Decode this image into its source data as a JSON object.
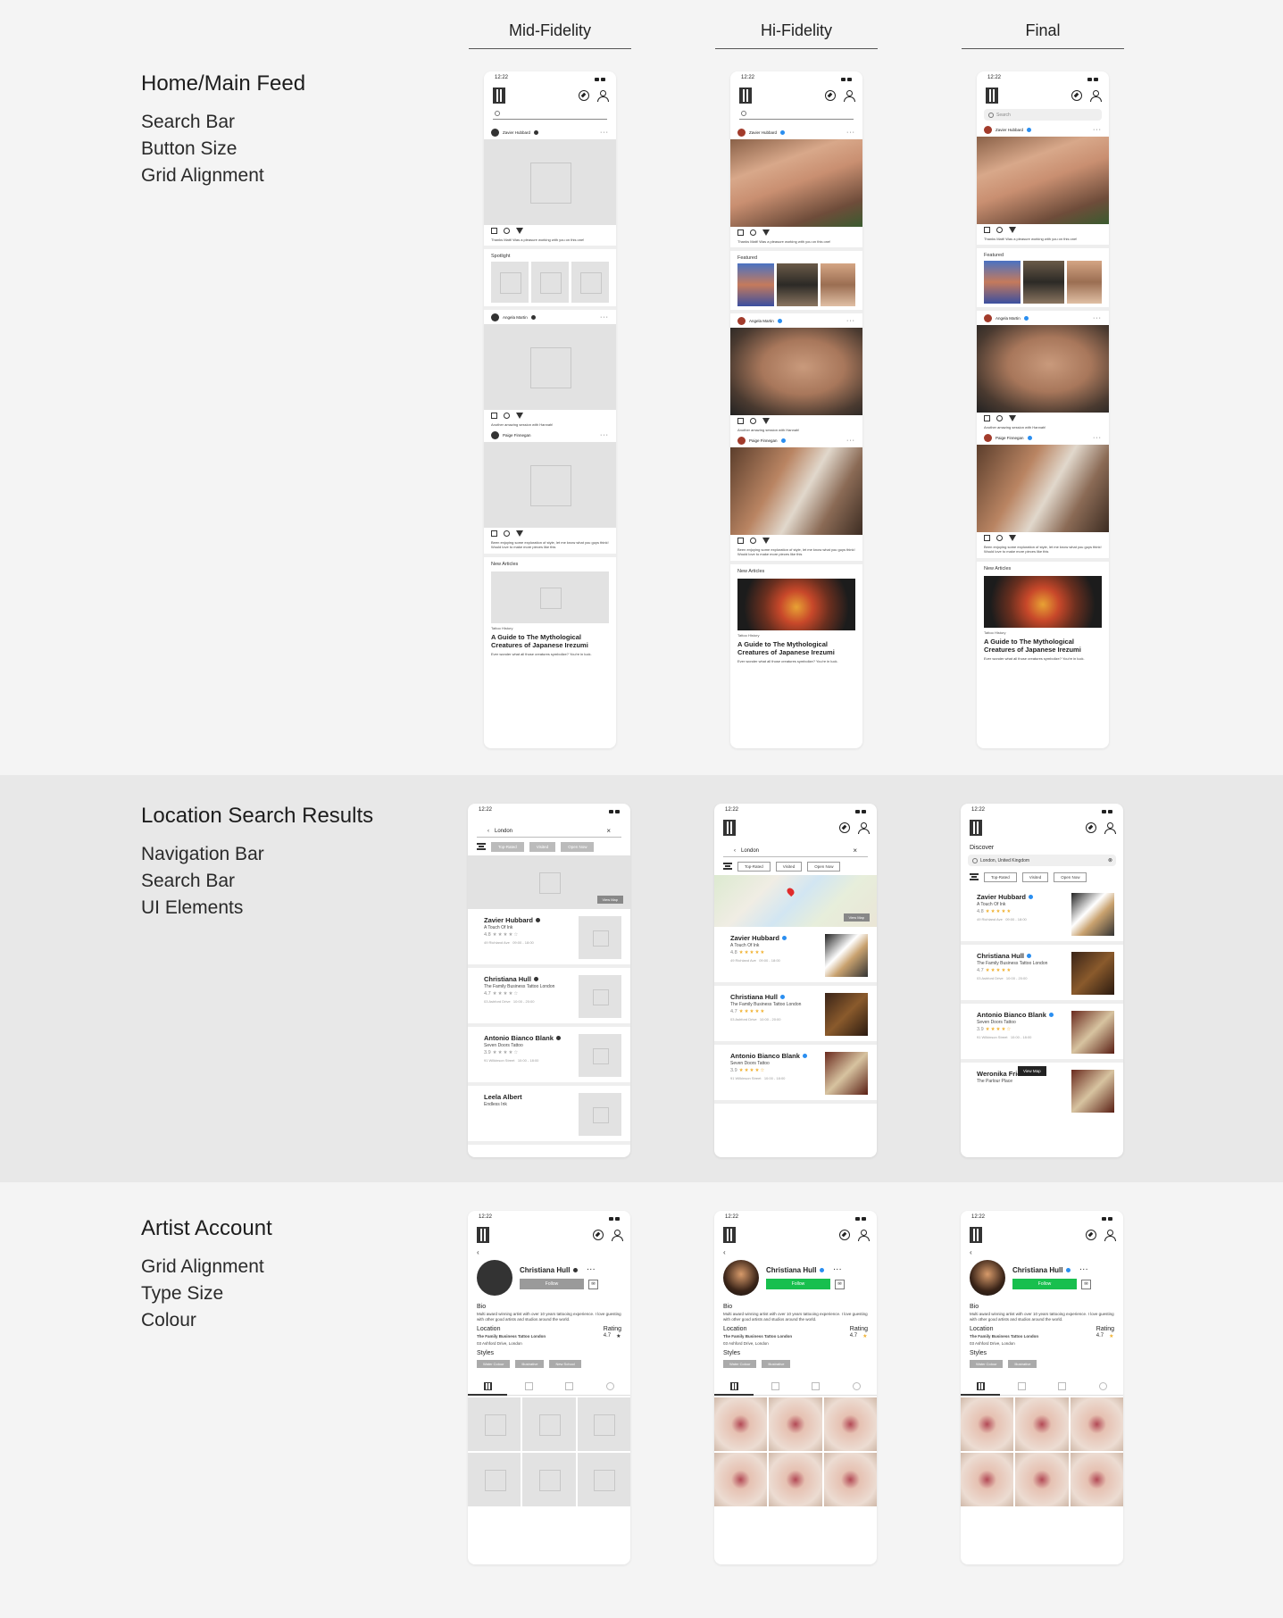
{
  "columns": [
    "Mid-Fidelity",
    "Hi-Fidelity",
    "Final"
  ],
  "sections": [
    {
      "title": "Home/Main Feed",
      "items": [
        "Search Bar",
        "Button Size",
        "Grid Alignment"
      ]
    },
    {
      "title": "Location Search Results",
      "items": [
        "Navigation Bar",
        "Search Bar",
        "UI Elements"
      ]
    },
    {
      "title": "Artist Account",
      "items": [
        "Grid Alignment",
        "Type Size",
        "Colour"
      ]
    }
  ],
  "status_time": "12:22",
  "feed": {
    "search_placeholder": "Search",
    "post1_user": "Zavier Hubbard",
    "post1_caption": "Thanks Matt! Was a pleasure working with you on this one!",
    "spotlight_label": "Spotlight",
    "featured_label": "Featured",
    "post2_user": "Angela Martin",
    "post2_caption": "Another amazing session with Hannah!",
    "post3_user": "Paige Finnegan",
    "post3_caption": "Been enjoying some exploration of style, let me know what you guys think! Would love to make more pieces like this",
    "new_articles_label": "New Articles",
    "article_tag": "Tattoo History",
    "article_title": "A Guide to The Mythological Creatures of Japanese Irezumi",
    "article_blurb": "Ever wonder what all those creatures symbolize? You're in luck."
  },
  "search": {
    "query": "London",
    "final_query": "London, United Kingdom",
    "discover_label": "Discover",
    "chips": [
      "Top-Rated",
      "Visited",
      "Open Now"
    ],
    "view_map": "View Map",
    "results": [
      {
        "name": "Zavier Hubbard",
        "shop": "A Touch Of Ink",
        "rating": "4.8",
        "addr": "49 Richland Ave",
        "hours": "09:00 - 18:00"
      },
      {
        "name": "Christiana Hull",
        "shop": "The Family Business Tattoo London",
        "rating": "4.7",
        "addr": "03 Ashford Drive",
        "hours": "10:00 - 20:00"
      },
      {
        "name": "Antonio Bianco Blank",
        "shop": "Seven Doors Tattoo",
        "rating": "3.9",
        "addr": "91 Wilkinson Street",
        "hours": "10:00 - 18:00"
      },
      {
        "name": "Leela Albert",
        "shop": "Endless Ink"
      },
      {
        "name": "Weronika Frie",
        "shop": "The Parlour Place"
      }
    ]
  },
  "profile": {
    "name": "Christiana Hull",
    "follow_label": "Follow",
    "bio_label": "Bio",
    "bio_text": "Multi award winning artist with over 10 years tattooing experience. I love guesting with other good artists and studios around the world.",
    "location_label": "Location",
    "location_shop": "The Family Business Tattoo London",
    "location_addr": "03 Ashford Drive, London",
    "rating_label": "Rating",
    "rating_value": "4.7",
    "styles_label": "Styles",
    "styles_mid": [
      "Water Colour",
      "Illustrative",
      "New School"
    ],
    "styles_final": [
      "Water Colour",
      "Illustrative"
    ]
  }
}
